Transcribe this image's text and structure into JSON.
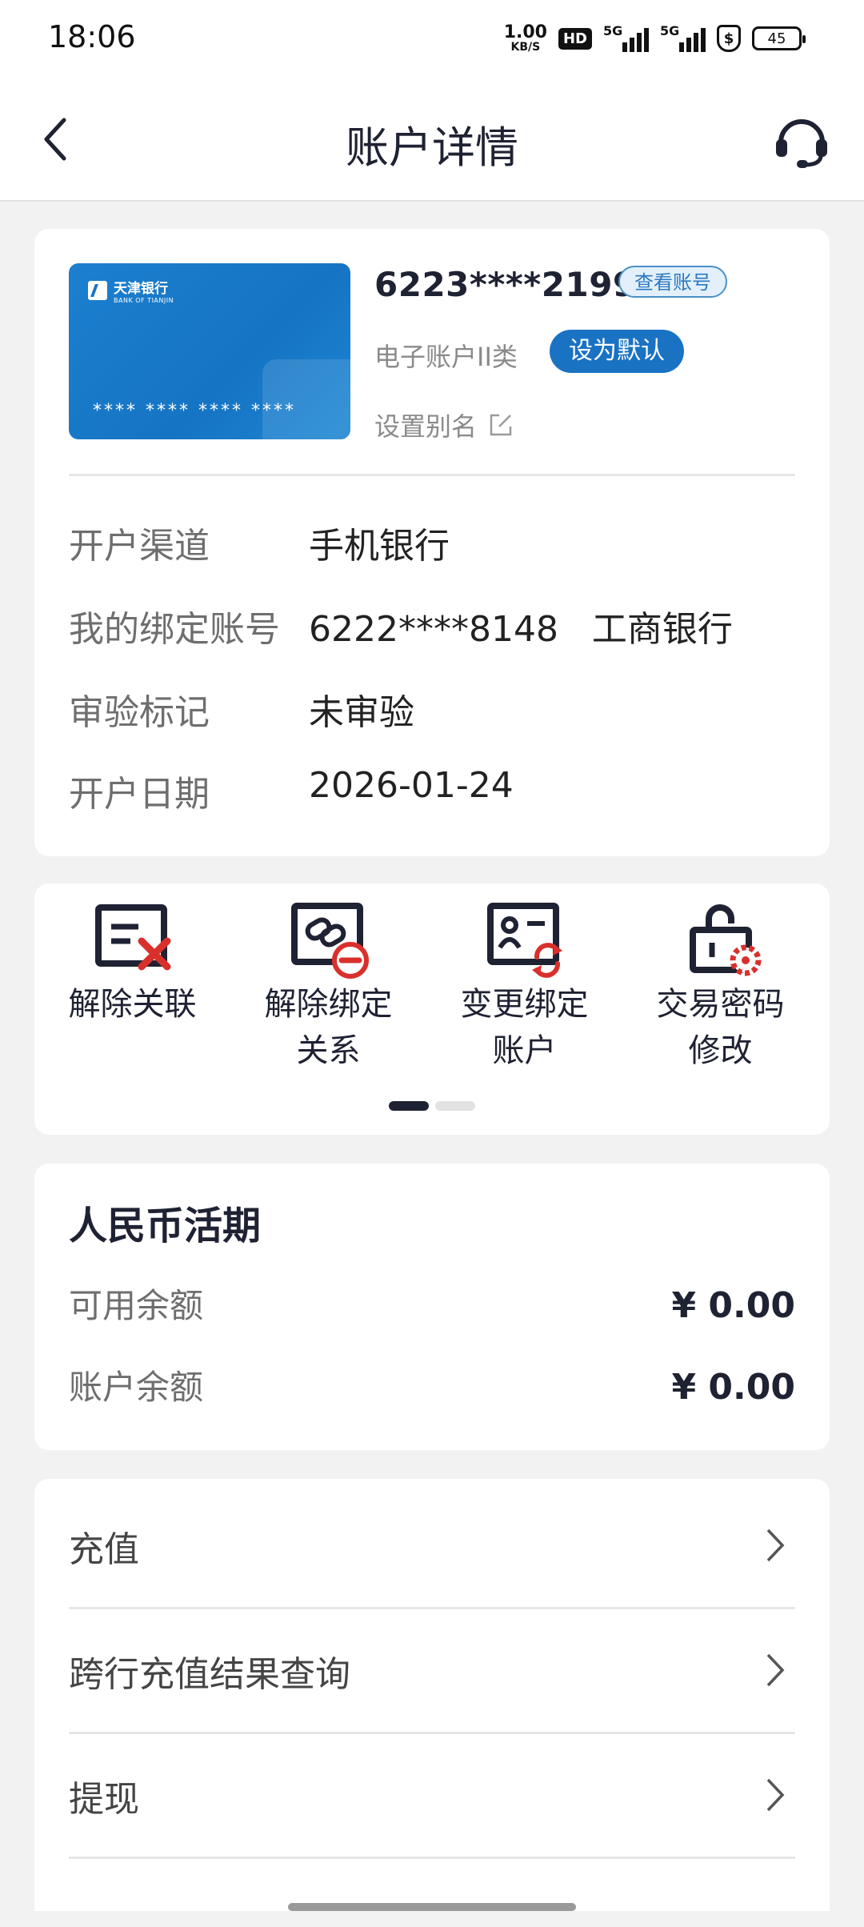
{
  "status_bar": {
    "time": "18:06",
    "speed_value": "1.00",
    "speed_unit": "KB/S",
    "hd_label": "HD",
    "network_1": "5G",
    "network_2": "5G",
    "battery": "45"
  },
  "header": {
    "title": "账户详情",
    "back_icon": "chevron-left-icon",
    "service_icon": "headset-icon"
  },
  "account": {
    "bank_name_cn": "天津银行",
    "bank_name_en": "BANK OF TIANJIN",
    "card_mask": "**** **** **** ****",
    "number": "6223****2199",
    "view_number_label": "查看账号",
    "type": "电子账户II类",
    "set_default_label": "设为默认",
    "alias_label": "设置别名",
    "rows": [
      {
        "label": "开户渠道",
        "value": "手机银行"
      },
      {
        "label": "我的绑定账号",
        "value": "6222****8148   工商银行"
      },
      {
        "label": "审验标记",
        "value": "未审验"
      },
      {
        "label": "开户日期",
        "value": "2026-01-24"
      }
    ]
  },
  "actions": [
    {
      "label": "解除关联",
      "icon": "unlink-doc-icon"
    },
    {
      "label": "解除绑定\n关系",
      "icon": "unbind-card-icon"
    },
    {
      "label": "变更绑定\n账户",
      "icon": "change-account-icon"
    },
    {
      "label": "交易密码\n修改",
      "icon": "lock-settings-icon"
    }
  ],
  "pager": {
    "pages": 2,
    "current": 1
  },
  "balance": {
    "title": "人民币活期",
    "available_label": "可用余额",
    "available_value": "¥ 0.00",
    "account_label": "账户余额",
    "account_value": "¥ 0.00"
  },
  "menu": [
    {
      "label": "充值"
    },
    {
      "label": "跨行充值结果查询"
    },
    {
      "label": "提现"
    }
  ],
  "colors": {
    "primary_blue": "#1a72c3",
    "dark_navy": "#1f2233",
    "accent_red": "#d9302c",
    "page_bg": "#f2f2f2"
  }
}
